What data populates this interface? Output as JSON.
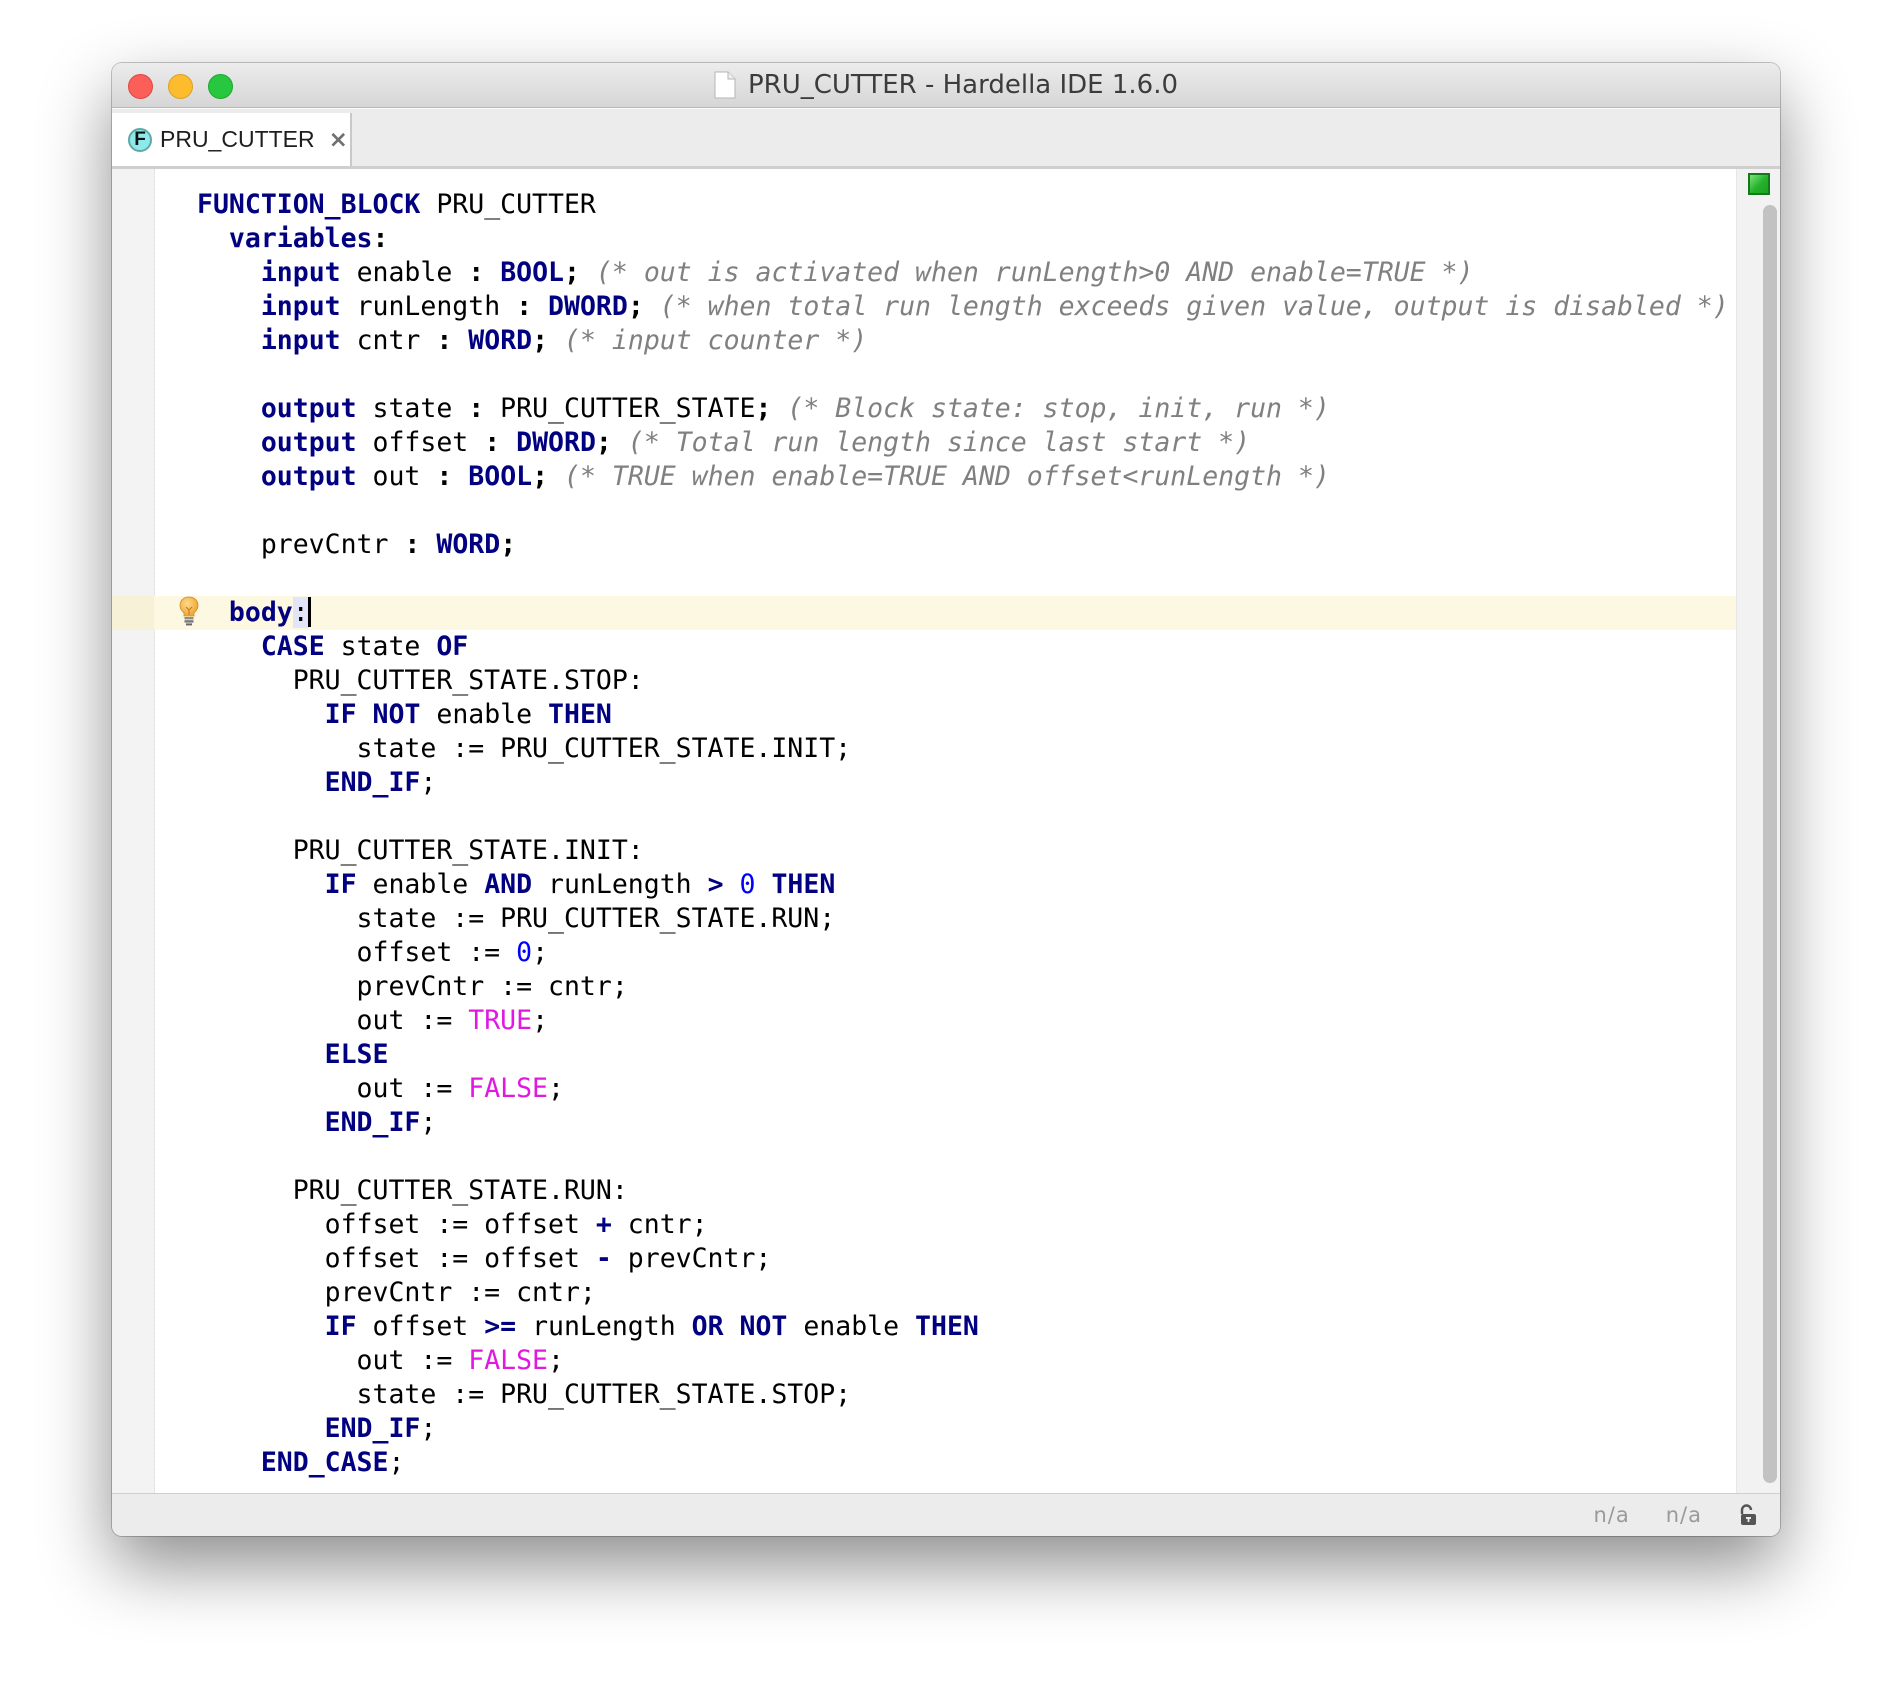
{
  "window": {
    "title": "PRU_CUTTER - Hardella IDE 1.6.0",
    "title_icon": "document-icon"
  },
  "tabs": [
    {
      "label": "PRU_CUTTER",
      "icon": "function-block-icon",
      "icon_letter": "F",
      "close_label": "×",
      "active": true
    }
  ],
  "editor": {
    "cursor_line": 13,
    "status_indicator": "ok",
    "lines": [
      [
        {
          "t": "FUNCTION_BLOCK",
          "c": "kw"
        },
        {
          "t": " PRU_CUTTER"
        }
      ],
      [
        {
          "t": "  "
        },
        {
          "t": "variables",
          "c": "kw"
        },
        {
          "t": ":",
          "c": "pn"
        }
      ],
      [
        {
          "t": "    "
        },
        {
          "t": "input",
          "c": "kw"
        },
        {
          "t": " enable "
        },
        {
          "t": ":",
          "c": "pn"
        },
        {
          "t": " "
        },
        {
          "t": "BOOL",
          "c": "kw"
        },
        {
          "t": ";",
          "c": "pn"
        },
        {
          "t": " "
        },
        {
          "t": "(* out is activated when runLength>0 AND enable=TRUE *)",
          "c": "cm"
        }
      ],
      [
        {
          "t": "    "
        },
        {
          "t": "input",
          "c": "kw"
        },
        {
          "t": " runLength "
        },
        {
          "t": ":",
          "c": "pn"
        },
        {
          "t": " "
        },
        {
          "t": "DWORD",
          "c": "kw"
        },
        {
          "t": ";",
          "c": "pn"
        },
        {
          "t": " "
        },
        {
          "t": "(* when total run length exceeds given value, output is disabled *)",
          "c": "cm"
        }
      ],
      [
        {
          "t": "    "
        },
        {
          "t": "input",
          "c": "kw"
        },
        {
          "t": " cntr "
        },
        {
          "t": ":",
          "c": "pn"
        },
        {
          "t": " "
        },
        {
          "t": "WORD",
          "c": "kw"
        },
        {
          "t": ";",
          "c": "pn"
        },
        {
          "t": " "
        },
        {
          "t": "(* input counter *)",
          "c": "cm"
        }
      ],
      [],
      [
        {
          "t": "    "
        },
        {
          "t": "output",
          "c": "kw"
        },
        {
          "t": " state "
        },
        {
          "t": ":",
          "c": "pn"
        },
        {
          "t": " PRU_CUTTER_STATE"
        },
        {
          "t": ";",
          "c": "pn"
        },
        {
          "t": " "
        },
        {
          "t": "(* Block state: stop, init, run *)",
          "c": "cm"
        }
      ],
      [
        {
          "t": "    "
        },
        {
          "t": "output",
          "c": "kw"
        },
        {
          "t": " offset "
        },
        {
          "t": ":",
          "c": "pn"
        },
        {
          "t": " "
        },
        {
          "t": "DWORD",
          "c": "kw"
        },
        {
          "t": ";",
          "c": "pn"
        },
        {
          "t": " "
        },
        {
          "t": "(* Total run length since last start *)",
          "c": "cm"
        }
      ],
      [
        {
          "t": "    "
        },
        {
          "t": "output",
          "c": "kw"
        },
        {
          "t": " out "
        },
        {
          "t": ":",
          "c": "pn"
        },
        {
          "t": " "
        },
        {
          "t": "BOOL",
          "c": "kw"
        },
        {
          "t": ";",
          "c": "pn"
        },
        {
          "t": " "
        },
        {
          "t": "(* TRUE when enable=TRUE AND offset<runLength *)",
          "c": "cm"
        }
      ],
      [],
      [
        {
          "t": "    prevCntr "
        },
        {
          "t": ":",
          "c": "pn"
        },
        {
          "t": " "
        },
        {
          "t": "WORD",
          "c": "kw"
        },
        {
          "t": ";",
          "c": "pn"
        }
      ],
      [],
      [
        {
          "t": "  "
        },
        {
          "t": "body",
          "c": "kw"
        },
        {
          "t": ":",
          "c": "sel"
        },
        {
          "t": "",
          "c": "cursor"
        }
      ],
      [
        {
          "t": "    "
        },
        {
          "t": "CASE",
          "c": "kw"
        },
        {
          "t": " state "
        },
        {
          "t": "OF",
          "c": "kw"
        }
      ],
      [
        {
          "t": "      PRU_CUTTER_STATE.STOP:"
        }
      ],
      [
        {
          "t": "        "
        },
        {
          "t": "IF",
          "c": "kw"
        },
        {
          "t": " "
        },
        {
          "t": "NOT",
          "c": "kw"
        },
        {
          "t": " enable "
        },
        {
          "t": "THEN",
          "c": "kw"
        }
      ],
      [
        {
          "t": "          state := PRU_CUTTER_STATE.INIT;"
        }
      ],
      [
        {
          "t": "        "
        },
        {
          "t": "END_IF",
          "c": "kw"
        },
        {
          "t": ";"
        }
      ],
      [],
      [
        {
          "t": "      PRU_CUTTER_STATE.INIT:"
        }
      ],
      [
        {
          "t": "        "
        },
        {
          "t": "IF",
          "c": "kw"
        },
        {
          "t": " enable "
        },
        {
          "t": "AND",
          "c": "kw"
        },
        {
          "t": " runLength "
        },
        {
          "t": ">",
          "c": "kw"
        },
        {
          "t": " "
        },
        {
          "t": "0",
          "c": "num"
        },
        {
          "t": " "
        },
        {
          "t": "THEN",
          "c": "kw"
        }
      ],
      [
        {
          "t": "          state := PRU_CUTTER_STATE.RUN;"
        }
      ],
      [
        {
          "t": "          offset := "
        },
        {
          "t": "0",
          "c": "num"
        },
        {
          "t": ";"
        }
      ],
      [
        {
          "t": "          prevCntr := cntr;"
        }
      ],
      [
        {
          "t": "          out := "
        },
        {
          "t": "TRUE",
          "c": "lit"
        },
        {
          "t": ";"
        }
      ],
      [
        {
          "t": "        "
        },
        {
          "t": "ELSE",
          "c": "kw"
        }
      ],
      [
        {
          "t": "          out := "
        },
        {
          "t": "FALSE",
          "c": "lit"
        },
        {
          "t": ";"
        }
      ],
      [
        {
          "t": "        "
        },
        {
          "t": "END_IF",
          "c": "kw"
        },
        {
          "t": ";"
        }
      ],
      [],
      [
        {
          "t": "      PRU_CUTTER_STATE.RUN:"
        }
      ],
      [
        {
          "t": "        offset := offset "
        },
        {
          "t": "+",
          "c": "kw"
        },
        {
          "t": " cntr;"
        }
      ],
      [
        {
          "t": "        offset := offset "
        },
        {
          "t": "-",
          "c": "kw"
        },
        {
          "t": " prevCntr;"
        }
      ],
      [
        {
          "t": "        prevCntr := cntr;"
        }
      ],
      [
        {
          "t": "        "
        },
        {
          "t": "IF",
          "c": "kw"
        },
        {
          "t": " offset "
        },
        {
          "t": ">=",
          "c": "kw"
        },
        {
          "t": " runLength "
        },
        {
          "t": "OR",
          "c": "kw"
        },
        {
          "t": " "
        },
        {
          "t": "NOT",
          "c": "kw"
        },
        {
          "t": " enable "
        },
        {
          "t": "THEN",
          "c": "kw"
        }
      ],
      [
        {
          "t": "          out := "
        },
        {
          "t": "FALSE",
          "c": "lit"
        },
        {
          "t": ";"
        }
      ],
      [
        {
          "t": "          state := PRU_CUTTER_STATE.STOP;"
        }
      ],
      [
        {
          "t": "        "
        },
        {
          "t": "END_IF",
          "c": "kw"
        },
        {
          "t": ";"
        }
      ],
      [
        {
          "t": "    "
        },
        {
          "t": "END_CASE",
          "c": "kw"
        },
        {
          "t": ";"
        }
      ]
    ]
  },
  "statusbar": {
    "cells": [
      "n/a",
      "n/a"
    ],
    "lock_icon": "unlocked-icon"
  },
  "colors": {
    "keyword": "#000080",
    "comment": "#808080",
    "number": "#0000ff",
    "literal": "#e018e0",
    "caret_line": "#fdf8e1",
    "status_ok": "#23b12b"
  }
}
